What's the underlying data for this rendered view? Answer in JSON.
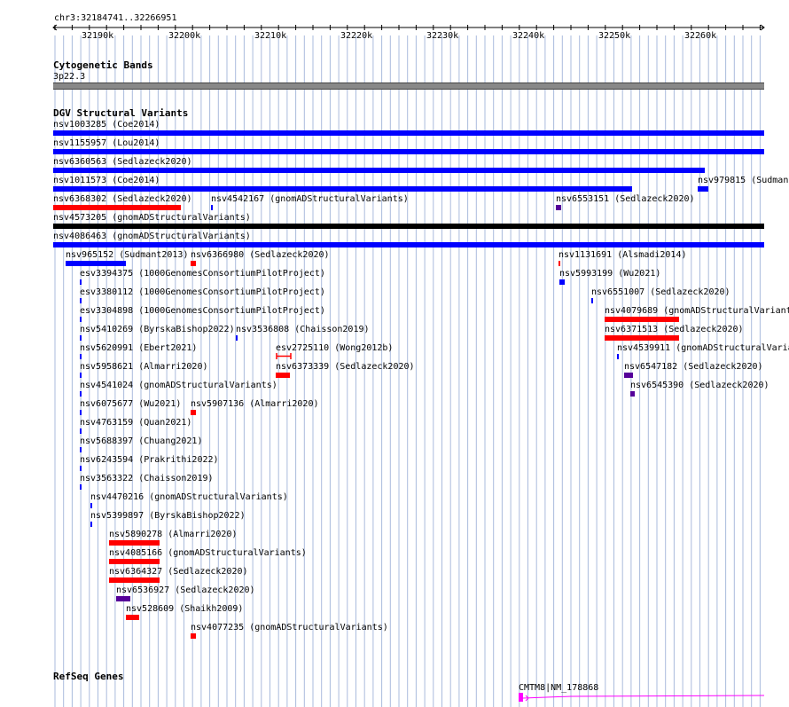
{
  "ruler": {
    "coordinates": "chr3:32184741..32266951",
    "ticks": [
      "32190k",
      "32200k",
      "32210k",
      "32220k",
      "32230k",
      "32240k",
      "32250k",
      "32260k"
    ]
  },
  "tracks": {
    "cytoband": {
      "title": "Cytogenetic Bands",
      "band": "3p22.3"
    },
    "dgv": {
      "title": "DGV Structural Variants"
    },
    "refseq": {
      "title": "RefSeq Genes",
      "gene": "CMTM8|NM_178868"
    }
  },
  "colors": {
    "gain": "#0000ff",
    "loss": "#ff0000",
    "complex": "#550099",
    "inversion": "#000000",
    "gene": "#ff00ff",
    "grid": "#aabbdd"
  },
  "variants": [
    {
      "label": "nsv1003285 (Coe2014)"
    },
    {
      "label": "nsv1155957 (Lou2014)"
    },
    {
      "label": "nsv6360563 (Sedlazeck2020)"
    },
    {
      "label": "nsv1011573 (Coe2014)"
    },
    {
      "label": "nsv979815 (Sudmant"
    },
    {
      "label": "nsv6368302 (Sedlazeck2020)"
    },
    {
      "label": "nsv4542167 (gnomADStructuralVariants)"
    },
    {
      "label": "nsv6553151 (Sedlazeck2020)"
    },
    {
      "label": "nsv4573205 (gnomADStructuralVariants)"
    },
    {
      "label": "nsv4086463 (gnomADStructuralVariants)"
    },
    {
      "label": "nsv965152 (Sudmant2013)"
    },
    {
      "label": "nsv6366980 (Sedlazeck2020)"
    },
    {
      "label": "nsv1131691 (Alsmadi2014)"
    },
    {
      "label": "esv3394375 (1000GenomesConsortiumPilotProject)"
    },
    {
      "label": "nsv5993199 (Wu2021)"
    },
    {
      "label": "esv3380112 (1000GenomesConsortiumPilotProject)"
    },
    {
      "label": "nsv6551007 (Sedlazeck2020)"
    },
    {
      "label": "esv3304898 (1000GenomesConsortiumPilotProject)"
    },
    {
      "label": "nsv4079689 (gnomADStructuralVariant"
    },
    {
      "label": "nsv5410269 (ByrskaBishop2022)"
    },
    {
      "label": "nsv3536808 (Chaisson2019)"
    },
    {
      "label": "nsv6371513 (Sedlazeck2020)"
    },
    {
      "label": "nsv5620991 (Ebert2021)"
    },
    {
      "label": "esv2725110 (Wong2012b)"
    },
    {
      "label": "nsv4539911 (gnomADStructuralVaria"
    },
    {
      "label": "nsv5958621 (Almarri2020)"
    },
    {
      "label": "nsv6373339 (Sedlazeck2020)"
    },
    {
      "label": "nsv6547182 (Sedlazeck2020)"
    },
    {
      "label": "nsv4541024 (gnomADStructuralVariants)"
    },
    {
      "label": "nsv6545390 (Sedlazeck2020)"
    },
    {
      "label": "nsv6075677 (Wu2021)"
    },
    {
      "label": "nsv5907136 (Almarri2020)"
    },
    {
      "label": "nsv4763159 (Quan2021)"
    },
    {
      "label": "nsv5688397 (Chuang2021)"
    },
    {
      "label": "nsv6243594 (Prakrithi2022)"
    },
    {
      "label": "nsv3563322 (Chaisson2019)"
    },
    {
      "label": "nsv4470216 (gnomADStructuralVariants)"
    },
    {
      "label": "nsv5399897 (ByrskaBishop2022)"
    },
    {
      "label": "nsv5890278 (Almarri2020)"
    },
    {
      "label": "nsv4085166 (gnomADStructuralVariants)"
    },
    {
      "label": "nsv6364327 (Sedlazeck2020)"
    },
    {
      "label": "nsv6536927 (Sedlazeck2020)"
    },
    {
      "label": "nsv528609 (Shaikh2009)"
    },
    {
      "label": "nsv4077235 (gnomADStructuralVariants)"
    }
  ]
}
